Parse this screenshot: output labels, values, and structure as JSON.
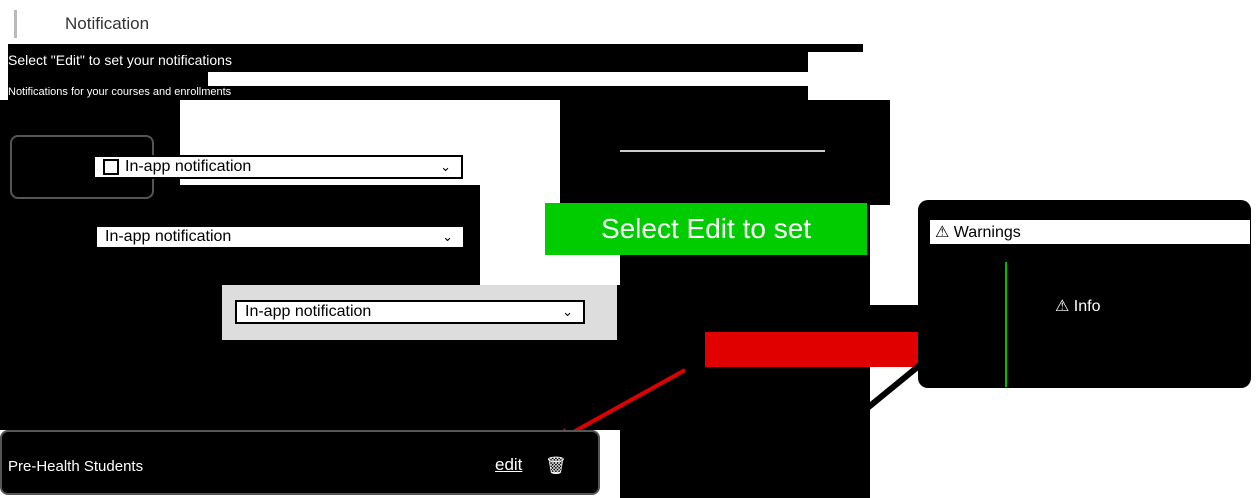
{
  "page": {
    "title": "Notification",
    "line1": "Select \"Edit\" to set your notifications",
    "line2": "Notifications for your courses and enrollments"
  },
  "selects": [
    {
      "value": "In-app notification"
    },
    {
      "value": "In-app notification"
    },
    {
      "value": "In-app notification"
    }
  ],
  "callout": {
    "text": "Select Edit to set"
  },
  "warnings_panel": {
    "warnings_label": "Warnings",
    "info_label": "Info"
  },
  "course_row": {
    "name": "Pre-Health Students",
    "edit_label": "edit"
  },
  "colors": {
    "accent_green": "#00cc00",
    "danger_red": "#e00000",
    "panel_black": "#000000"
  },
  "icons": [
    "chevron-down-icon",
    "warning-icon",
    "trash-icon",
    "checkbox-icon"
  ]
}
